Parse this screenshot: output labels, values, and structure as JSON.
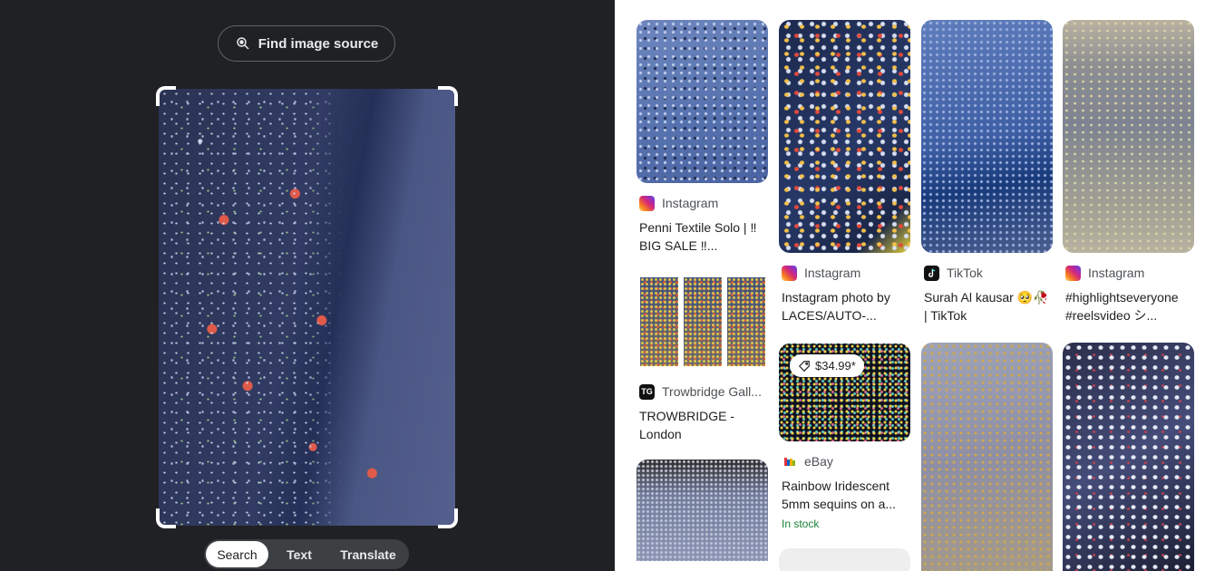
{
  "lens": {
    "find_source_label": "Find image source",
    "tabs": [
      {
        "label": "Search",
        "active": true
      },
      {
        "label": "Text",
        "active": false
      },
      {
        "label": "Translate",
        "active": false
      }
    ]
  },
  "results": [
    {
      "source": "Instagram",
      "source_icon": "instagram-icon",
      "title": "Penni Textile Solo | ‼ BIG SALE ‼..."
    },
    {
      "source": "Instagram",
      "source_icon": "instagram-icon",
      "title": "Instagram photo by LACES/AUTO-..."
    },
    {
      "source": "TikTok",
      "source_icon": "tiktok-icon",
      "title": "Surah Al kausar 🥺🥀 | TikTok"
    },
    {
      "source": "Instagram",
      "source_icon": "instagram-icon",
      "title": "#highlightseveryone #reelsvideo シ..."
    },
    {
      "source": "Trowbridge Gall...",
      "source_icon": "tg-icon",
      "source_icon_text": "TG",
      "title": "TROWBRIDGE - London"
    },
    {
      "price": "$34.99*",
      "source": "eBay",
      "source_icon": "ebay-icon",
      "title": "Rainbow Iridescent 5mm sequins on a...",
      "stock": "In stock"
    }
  ],
  "colors": {
    "left_panel_bg": "#202124",
    "tab_bar_bg": "#3c4043",
    "stock_green": "#188038"
  }
}
